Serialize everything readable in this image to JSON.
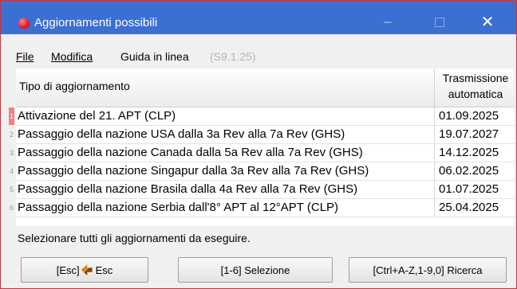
{
  "window": {
    "title": "Aggiornamenti possibili",
    "accent_color": "#3b6fd2",
    "border_color": "#c6363c",
    "controls": {
      "minimize": "–",
      "close": "✕"
    }
  },
  "menu": {
    "file": "File",
    "edit": "Modifica",
    "help": "Guida in linea",
    "version": "(S9.1.25)"
  },
  "table": {
    "headers": {
      "type": "Tipo di aggiornamento",
      "transmission_line1": "Trasmissione",
      "transmission_line2": "automatica"
    },
    "rows": [
      {
        "marker": "1",
        "type": "Attivazione del 21. APT (CLP)",
        "date": "01.09.2025"
      },
      {
        "marker": "2",
        "type": "Passaggio della nazione USA dalla 3a Rev alla 7a Rev (GHS)",
        "date": "19.07.2027"
      },
      {
        "marker": "3",
        "type": "Passaggio della nazione Canada dalla 5a Rev alla 7a Rev (GHS)",
        "date": "14.12.2025"
      },
      {
        "marker": "4",
        "type": "Passaggio della nazione Singapur dalla 3a Rev alla 7a Rev (GHS)",
        "date": "06.02.2025"
      },
      {
        "marker": "5",
        "type": "Passaggio della nazione Brasila dalla 4a Rev alla 7a Rev (GHS)",
        "date": "01.07.2025"
      },
      {
        "marker": "6",
        "type": "Passaggio della nazione Serbia dall'8° APT al 12°APT (CLP)",
        "date": "25.04.2025"
      }
    ]
  },
  "status": "Selezionare tutti gli aggiornamenti da eseguire.",
  "buttons": {
    "esc_key": "[Esc]",
    "esc_label": "Esc",
    "select": "[1-6] Selezione",
    "search": "[Ctrl+A-Z,1-9,0] Ricerca"
  }
}
